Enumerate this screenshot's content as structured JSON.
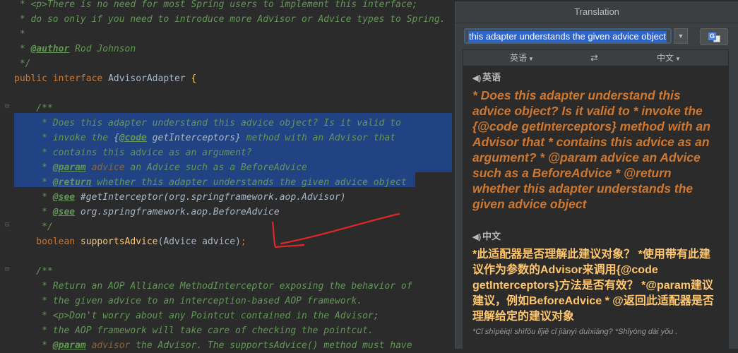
{
  "editor": {
    "lines": [
      [
        {
          "c": "cm",
          "t": " * "
        },
        {
          "c": "cm",
          "t": "<p>"
        },
        {
          "c": "cm",
          "t": "There is no need for most Spring users to implement this interface;"
        }
      ],
      [
        {
          "c": "cm",
          "t": " * do so only if you need to introduce more Advisor or Advice types to Spring."
        }
      ],
      [
        {
          "c": "cm",
          "t": " *"
        }
      ],
      [
        {
          "c": "cm",
          "t": " * "
        },
        {
          "c": "tg",
          "t": "@author"
        },
        {
          "c": "cm",
          "t": " Rod Johnson"
        }
      ],
      [
        {
          "c": "cm",
          "t": " */"
        }
      ],
      [
        {
          "c": "kw",
          "t": "public interface "
        },
        {
          "c": "plain",
          "t": "AdvisorAdapter "
        },
        {
          "c": "fn",
          "t": "{"
        }
      ],
      [
        {
          "c": "plain",
          "t": ""
        }
      ],
      [
        {
          "c": "cm",
          "t": "    /**"
        }
      ],
      [
        {
          "c": "cm",
          "t": "     * Does this adapter understand this advice object? Is it valid to"
        }
      ],
      [
        {
          "c": "cm",
          "t": "     * invoke the "
        },
        {
          "c": "ref",
          "t": "{"
        },
        {
          "c": "tg",
          "t": "@code"
        },
        {
          "c": "ref",
          "t": " getInterceptors}"
        },
        {
          "c": "cm",
          "t": " method with an Advisor that"
        }
      ],
      [
        {
          "c": "cm",
          "t": "     * contains this advice as an argument?"
        }
      ],
      [
        {
          "c": "cm",
          "t": "     * "
        },
        {
          "c": "tg",
          "t": "@param"
        },
        {
          "c": "par",
          "t": " advice"
        },
        {
          "c": "cm",
          "t": " an Advice such as a BeforeAdvice"
        }
      ],
      [
        {
          "c": "cm",
          "t": "     * "
        },
        {
          "c": "tg",
          "t": "@return"
        },
        {
          "c": "cm",
          "t": " whether this adapter understands the given advice object"
        }
      ],
      [
        {
          "c": "cm",
          "t": "     * "
        },
        {
          "c": "tg",
          "t": "@see"
        },
        {
          "c": "ref",
          "t": " #getInterceptor(org.springframework.aop.Advisor)"
        }
      ],
      [
        {
          "c": "cm",
          "t": "     * "
        },
        {
          "c": "tg",
          "t": "@see"
        },
        {
          "c": "ref",
          "t": " org.springframework.aop.BeforeAdvice"
        }
      ],
      [
        {
          "c": "cm",
          "t": "     */"
        }
      ],
      [
        {
          "c": "kw",
          "t": "    boolean "
        },
        {
          "c": "fn",
          "t": "supportsAdvice"
        },
        {
          "c": "plain",
          "t": "(Advice advice)"
        },
        {
          "c": "kw",
          "t": ";"
        }
      ],
      [
        {
          "c": "plain",
          "t": ""
        }
      ],
      [
        {
          "c": "cm",
          "t": "    /**"
        }
      ],
      [
        {
          "c": "cm",
          "t": "     * Return an AOP Alliance MethodInterceptor exposing the behavior of"
        }
      ],
      [
        {
          "c": "cm",
          "t": "     * the given advice to an interception-based AOP framework."
        }
      ],
      [
        {
          "c": "cm",
          "t": "     * <p>Don't worry about any Pointcut contained in the Advisor;"
        }
      ],
      [
        {
          "c": "cm",
          "t": "     * the AOP framework will take care of checking the pointcut."
        }
      ],
      [
        {
          "c": "cm",
          "t": "     * "
        },
        {
          "c": "tg",
          "t": "@param"
        },
        {
          "c": "par",
          "t": " advisor"
        },
        {
          "c": "cm",
          "t": " the Advisor. The supportsAdvice() method must have"
        }
      ]
    ]
  },
  "translation": {
    "title": "Translation",
    "query": "this adapter understands the given advice object",
    "source_lang": "英语",
    "target_lang": "中文",
    "swap_glyph": "⇄",
    "source_heading": "英语",
    "target_heading": "中文",
    "source_text": "* Does this adapter understand this advice object? Is it valid to * invoke the {@code getInterceptors} method with an Advisor that * contains this advice as an argument? * @param advice an Advice such as a BeforeAdvice * @return whether this adapter understands the given advice object",
    "target_text": "*此适配器是否理解此建议对象？ *使用带有此建议作为参数的Advisor来调用{@code getInterceptors}方法是否有效？ *@param建议建议，例如BeforeAdvice * @返回此适配器是否理解给定的建议对象",
    "pinyin": "*Cǐ shìpèiqì shìfǒu lǐjiě cǐ jiànyì duìxiàng? *Shǐyòng dài yǒu ."
  },
  "colors": {
    "arrow": "#e0262b",
    "selection": "#214283"
  }
}
